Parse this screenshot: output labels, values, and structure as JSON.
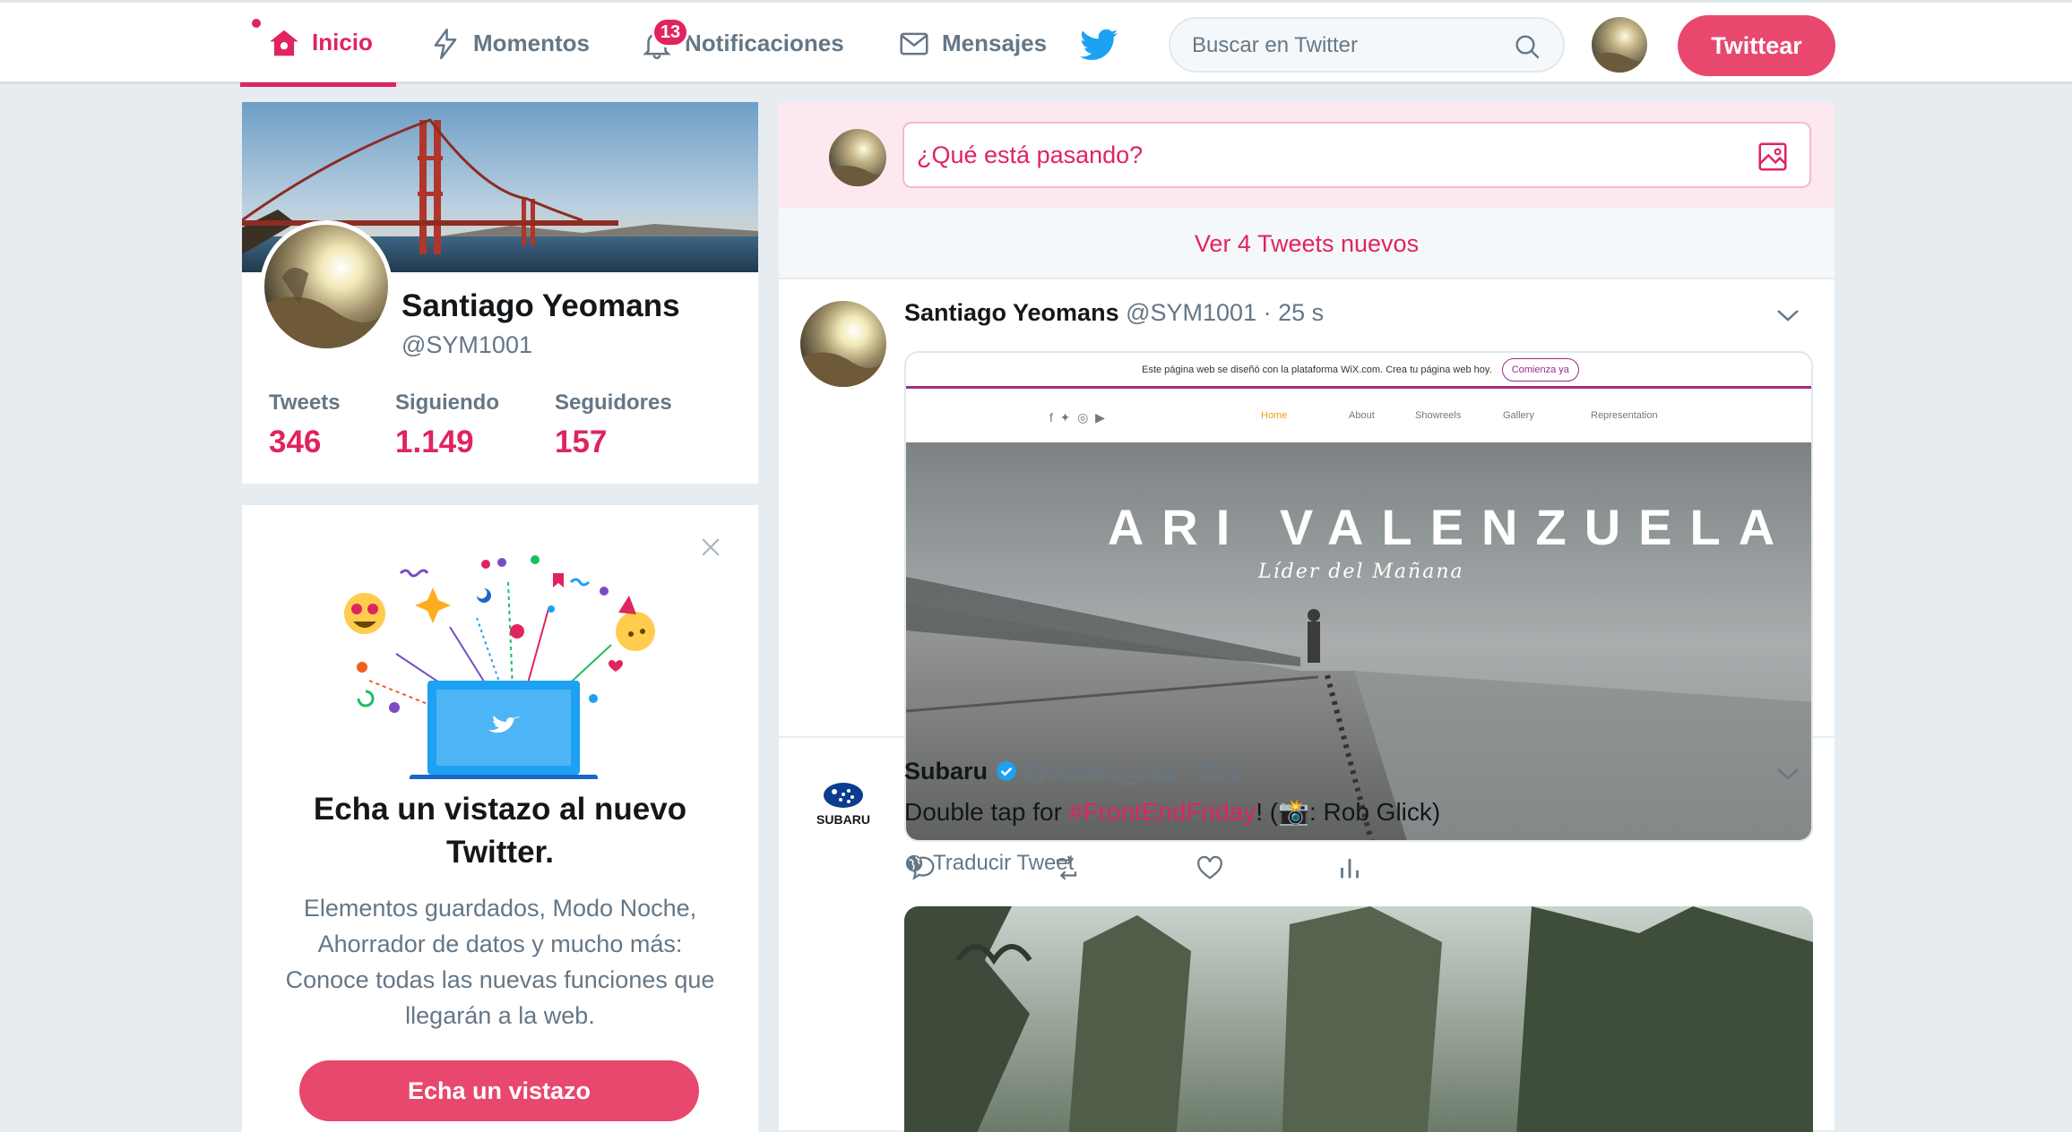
{
  "nav": {
    "home_label": "Inicio",
    "moments_label": "Momentos",
    "notifications_label": "Notificaciones",
    "notifications_count": "13",
    "messages_label": "Mensajes",
    "search_placeholder": "Buscar en Twitter",
    "tweet_button": "Twittear"
  },
  "profile": {
    "name": "Santiago Yeomans",
    "handle": "@SYM1001",
    "stats": [
      {
        "label": "Tweets",
        "value": "346"
      },
      {
        "label": "Siguiendo",
        "value": "1.149"
      },
      {
        "label": "Seguidores",
        "value": "157"
      }
    ]
  },
  "promo": {
    "title": "Echa un vistazo al nuevo Twitter.",
    "body": "Elementos guardados, Modo Noche, Ahorrador de datos y mucho más: Conoce todas las nuevas funciones que llegarán a la web.",
    "button": "Echa un vistazo"
  },
  "composer": {
    "placeholder": "¿Qué está pasando?"
  },
  "new_tweets_label": "Ver 4 Tweets nuevos",
  "tweets": [
    {
      "name": "Santiago Yeomans",
      "handle": "@SYM1001",
      "time": "· 25 s",
      "card": {
        "wix_banner": "Este página web se diseñó con la plataforma WiX.com. Crea tu página web hoy.",
        "wix_cta": "Comienza ya",
        "site_nav": [
          "Home",
          "About",
          "Showreels",
          "Gallery",
          "Representation"
        ],
        "hero_title": "ARI VALENZUELA",
        "hero_subtitle": "Líder del Mañana"
      }
    },
    {
      "name": "Subaru",
      "handle": "@subaru_usa",
      "time": "· 32 s",
      "text_before": "Double tap for ",
      "hashtag": "#FrontEndFriday",
      "text_after": "! (📸: Rob Glick)",
      "translate": "Traducir Tweet",
      "logo_text": "SUBARU"
    }
  ],
  "colors": {
    "accent": "#e0245e",
    "button": "#e8486e",
    "secondary_text": "#657786",
    "background": "#e6ecf0",
    "twitter_blue": "#1da1f2"
  }
}
